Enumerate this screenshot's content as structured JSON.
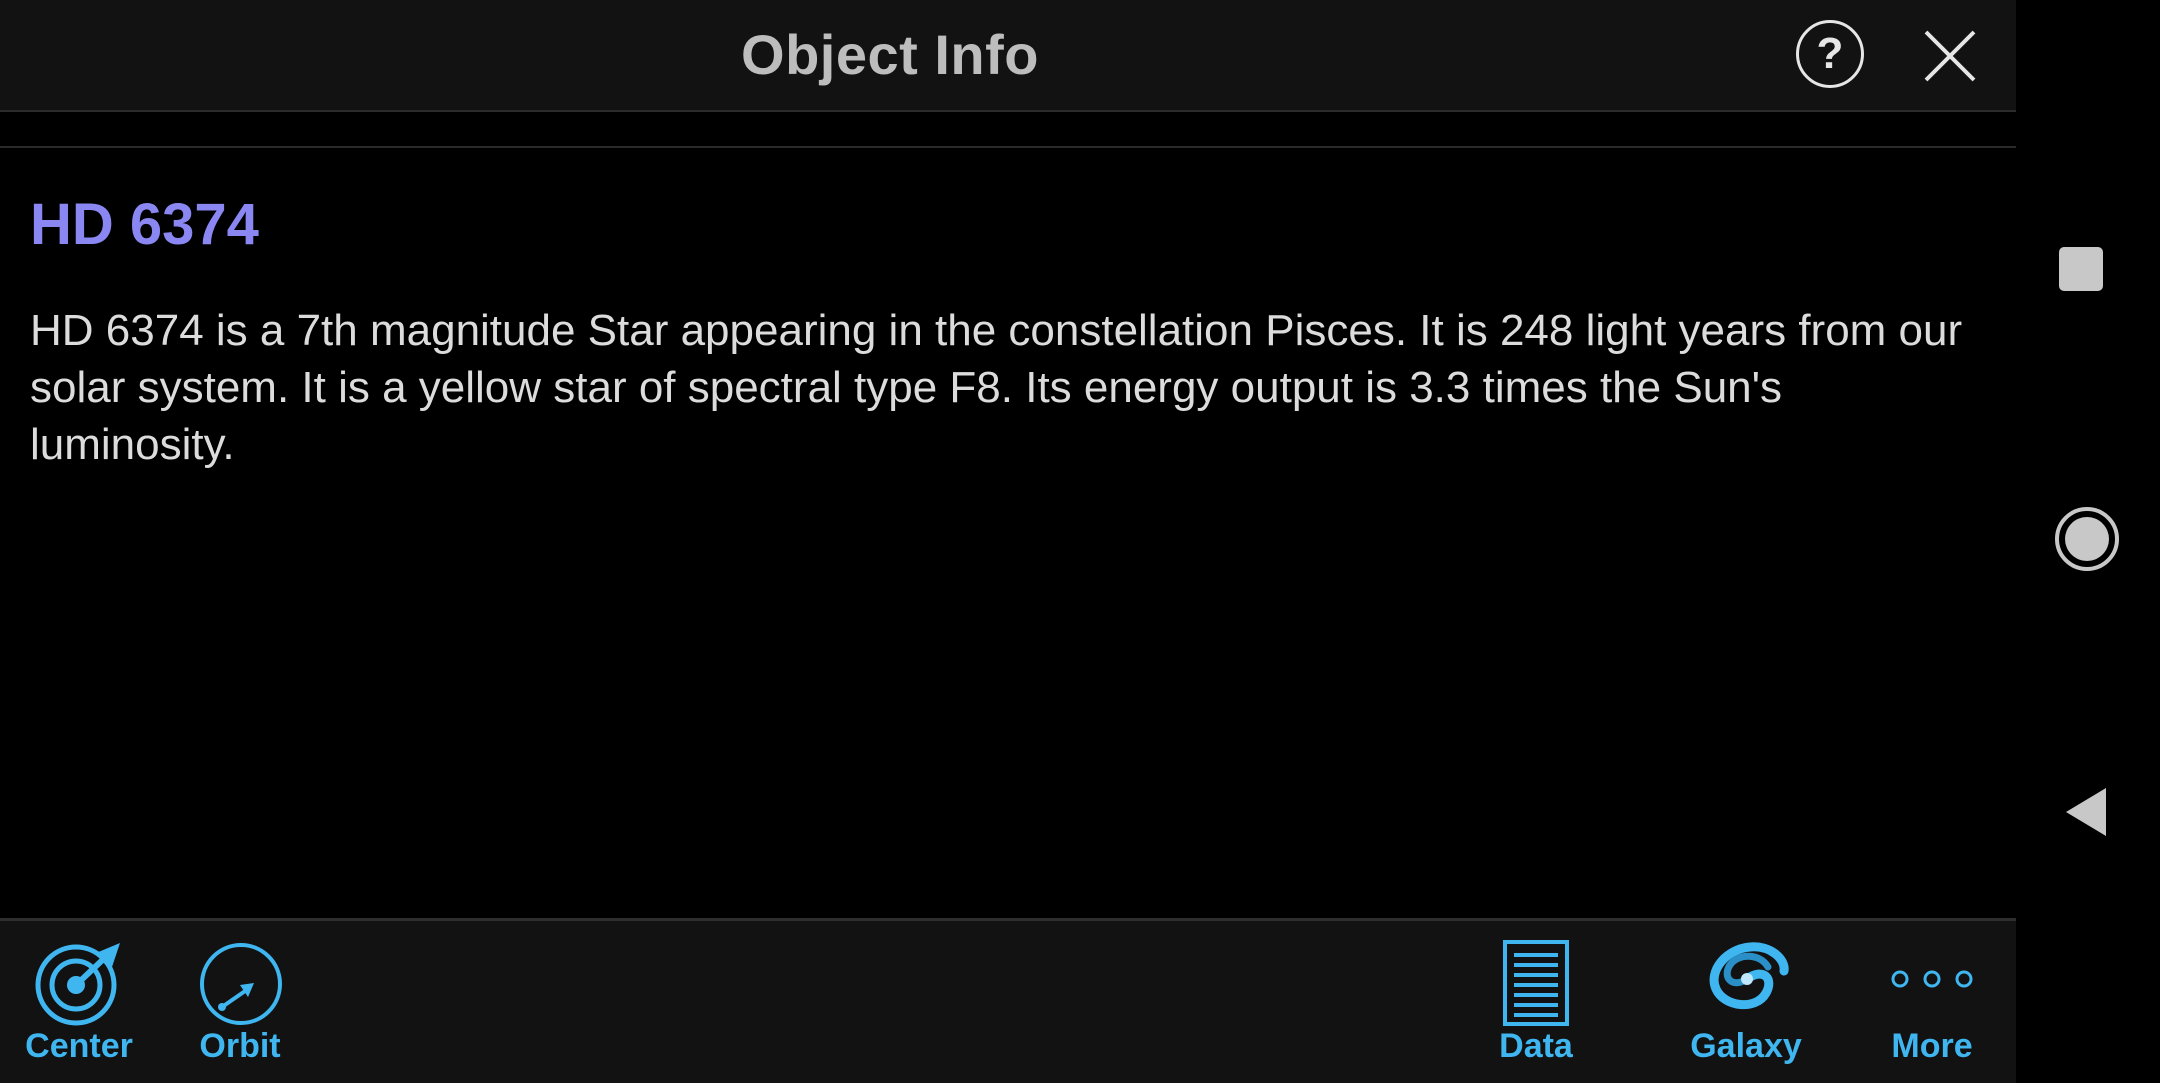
{
  "header": {
    "title": "Object Info",
    "help_label": "?"
  },
  "object": {
    "name": "HD 6374",
    "description": "HD 6374 is a 7th magnitude Star appearing in the constellation Pisces. It is 248 light years from our solar system. It is a yellow star of spectral type F8. Its energy output is 3.3 times the Sun's luminosity."
  },
  "toolbar": {
    "center": "Center",
    "orbit": "Orbit",
    "data": "Data",
    "galaxy": "Galaxy",
    "more": "More"
  },
  "colors": {
    "accent": "#3fb6f0",
    "object_name": "#8a87f2",
    "background": "#000000",
    "bar": "#121212"
  },
  "icons": {
    "help": "help-icon",
    "close": "close-icon",
    "center": "target-icon",
    "orbit": "orbit-icon",
    "data": "data-list-icon",
    "galaxy": "galaxy-icon",
    "more": "more-dots-icon",
    "nav_recent": "square-icon",
    "nav_home": "circle-icon",
    "nav_back": "back-triangle-icon"
  }
}
